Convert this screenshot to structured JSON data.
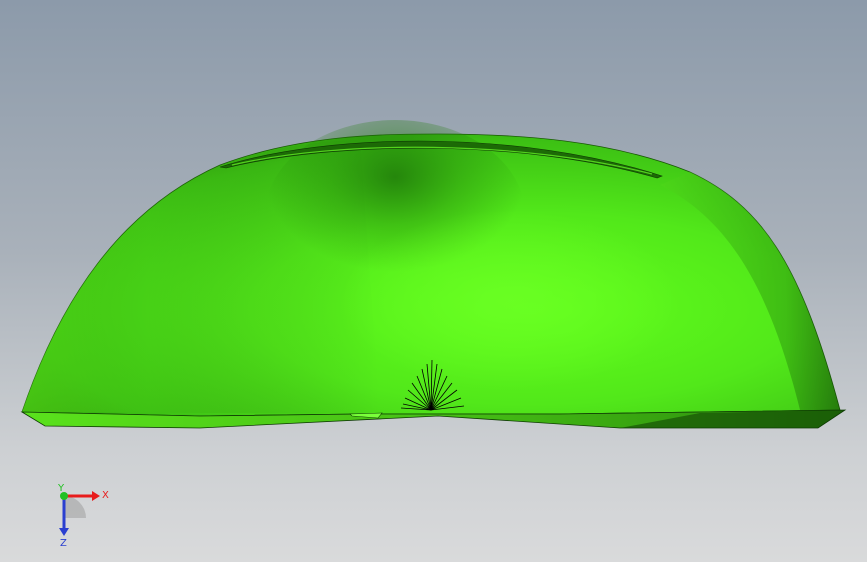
{
  "viewport": {
    "background_top": "#8c9aaa",
    "background_bottom": "#d9dadb"
  },
  "model": {
    "part_color": "#5cf01a",
    "shadow_color": "#1f7a08",
    "edge_color": "#000000"
  },
  "triad": {
    "x_label": "X",
    "y_label": "Y",
    "z_label": "Z",
    "x_color": "#e81c1c",
    "y_color": "#22c022",
    "z_color": "#2a3fd0"
  }
}
